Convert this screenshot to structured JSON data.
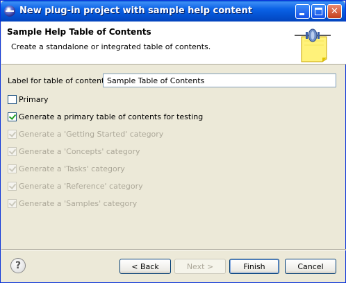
{
  "window": {
    "title": "New plug-in project with sample help content"
  },
  "header": {
    "title": "Sample Help Table of Contents",
    "description": "Create a standalone or integrated table of contents."
  },
  "form": {
    "toc_label": "Label for table of contents:",
    "toc_value": "Sample Table of Contents",
    "primary_label": "Primary",
    "primary_checked": false,
    "generate_primary_label": "Generate a primary table of contents for testing",
    "generate_primary_checked": true,
    "categories": [
      {
        "label": "Generate a 'Getting Started' category",
        "checked": true,
        "enabled": false
      },
      {
        "label": "Generate a 'Concepts' category",
        "checked": true,
        "enabled": false
      },
      {
        "label": "Generate a 'Tasks' category",
        "checked": true,
        "enabled": false
      },
      {
        "label": "Generate a 'Reference' category",
        "checked": true,
        "enabled": false
      },
      {
        "label": "Generate a 'Samples' category",
        "checked": true,
        "enabled": false
      }
    ]
  },
  "buttons": {
    "help": "?",
    "back": "< Back",
    "next": "Next >",
    "finish": "Finish",
    "cancel": "Cancel"
  },
  "colors": {
    "titlebar": "#0453d3",
    "dialog_bg": "#ece9d8",
    "check_green": "#21a121",
    "disabled_text": "#aca899"
  }
}
